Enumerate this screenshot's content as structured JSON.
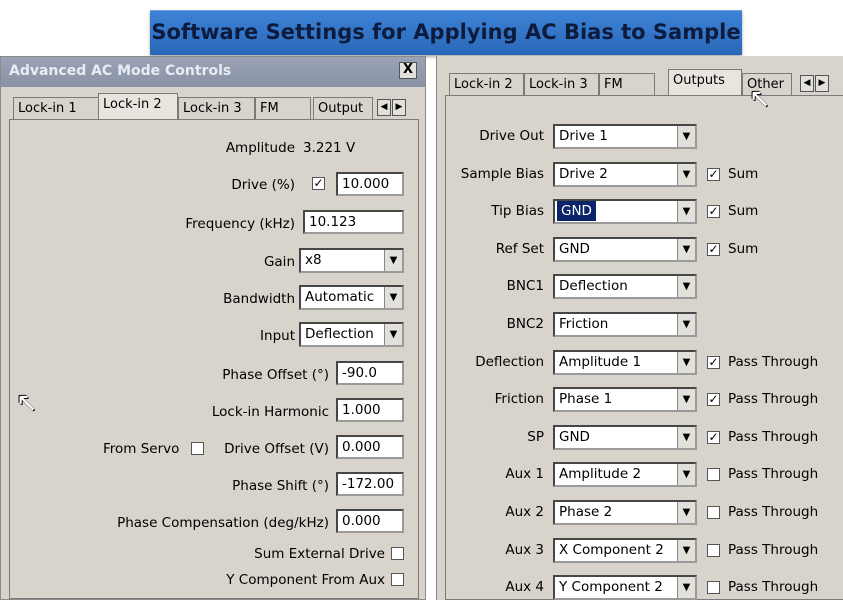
{
  "banner": {
    "title": "Software Settings for Applying AC Bias to Sample"
  },
  "left_window": {
    "title": "Advanced AC Mode Controls",
    "close_label": "X",
    "tabs": [
      "Lock-in 1",
      "Lock-in 2",
      "Lock-in 3",
      "FM",
      "Output"
    ],
    "active_tab": "Lock-in 2",
    "amplitude": {
      "label": "Amplitude",
      "value": "3.221 V"
    },
    "drive": {
      "label": "Drive (%)",
      "checked": "✓",
      "value": "10.000"
    },
    "frequency": {
      "label": "Frequency (kHz)",
      "value": "10.123"
    },
    "gain": {
      "label": "Gain",
      "value": "x8"
    },
    "bandwidth": {
      "label": "Bandwidth",
      "value": "Automatic"
    },
    "input": {
      "label": "Input",
      "value": "Deflection"
    },
    "phase_offset": {
      "label": "Phase Offset (°)",
      "value": "-90.0"
    },
    "lockin_harmonic": {
      "label": "Lock-in Harmonic",
      "value": "1.000"
    },
    "from_servo": {
      "label": "From Servo"
    },
    "drive_offset": {
      "label": "Drive Offset (V)",
      "value": "0.000"
    },
    "phase_shift": {
      "label": "Phase Shift (°)",
      "value": "-172.00"
    },
    "phase_comp": {
      "label": "Phase Compensation (deg/kHz)",
      "value": "0.000"
    },
    "sum_external": {
      "label": "Sum External Drive"
    },
    "y_component": {
      "label": "Y Component From Aux"
    }
  },
  "right_window": {
    "tabs": [
      "Lock-in 2",
      "Lock-in 3",
      "FM",
      "Outputs",
      "Other"
    ],
    "active_tab": "Outputs",
    "rows": [
      {
        "label": "Drive Out",
        "value": "Drive 1",
        "check": "",
        "check_label": ""
      },
      {
        "label": "Sample Bias",
        "value": "Drive 2",
        "check": "✓",
        "check_label": "Sum"
      },
      {
        "label": "Tip Bias",
        "value": "GND",
        "check": "✓",
        "check_label": "Sum"
      },
      {
        "label": "Ref Set",
        "value": "GND",
        "check": "✓",
        "check_label": "Sum"
      },
      {
        "label": "BNC1",
        "value": "Deflection",
        "check": "",
        "check_label": ""
      },
      {
        "label": "BNC2",
        "value": "Friction",
        "check": "",
        "check_label": ""
      },
      {
        "label": "Deflection",
        "value": "Amplitude 1",
        "check": "✓",
        "check_label": "Pass Through"
      },
      {
        "label": "Friction",
        "value": "Phase 1",
        "check": "✓",
        "check_label": "Pass Through"
      },
      {
        "label": "SP",
        "value": "GND",
        "check": "✓",
        "check_label": "Pass Through"
      },
      {
        "label": "Aux 1",
        "value": "Amplitude 2",
        "check": "",
        "check_label": "Pass Through"
      },
      {
        "label": "Aux 2",
        "value": "Phase 2",
        "check": "",
        "check_label": "Pass Through"
      },
      {
        "label": "Aux 3",
        "value": "X Component 2",
        "check": "",
        "check_label": "Pass Through"
      },
      {
        "label": "Aux 4",
        "value": "Y Component 2",
        "check": "",
        "check_label": "Pass Through"
      }
    ]
  },
  "icons": {
    "dropdown": "▼",
    "arrow_left": "◀",
    "arrow_right": "▶",
    "cursor": "mouse-pointer-icon"
  }
}
